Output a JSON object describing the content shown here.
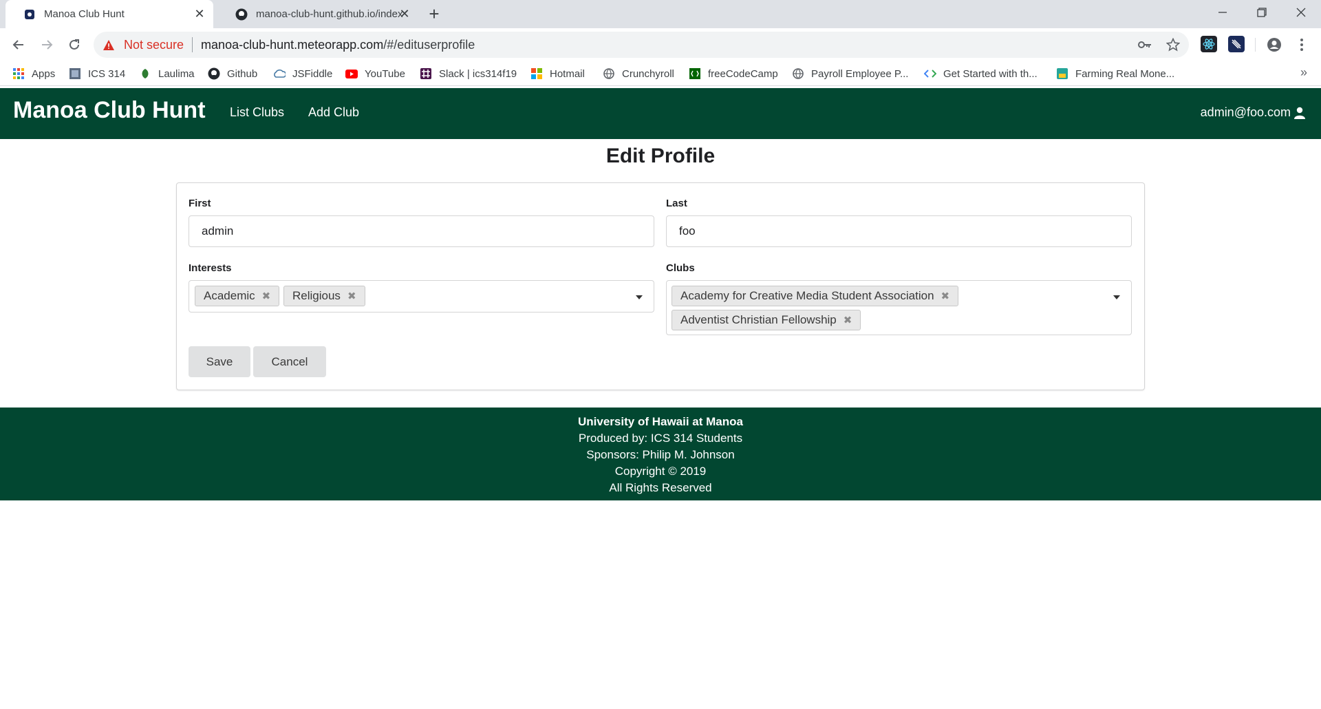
{
  "browser": {
    "tabs": [
      {
        "title": "Manoa Club Hunt",
        "active": true
      },
      {
        "title": "manoa-club-hunt.github.io/index",
        "active": false
      }
    ],
    "security_label": "Not secure",
    "url_host": "manoa-club-hunt.meteorapp.com",
    "url_path": "/#/edituserprofile",
    "bookmarks": [
      {
        "label": "Apps",
        "icon": "apps-grid-icon"
      },
      {
        "label": "ICS 314",
        "icon": "ics-icon"
      },
      {
        "label": "Laulima",
        "icon": "laulima-icon"
      },
      {
        "label": "Github",
        "icon": "github-icon"
      },
      {
        "label": "JSFiddle",
        "icon": "jsfiddle-icon"
      },
      {
        "label": "YouTube",
        "icon": "youtube-icon"
      },
      {
        "label": "Slack | ics314f19",
        "icon": "slack-icon"
      },
      {
        "label": "Hotmail",
        "icon": "microsoft-icon"
      },
      {
        "label": "Crunchyroll",
        "icon": "globe-icon"
      },
      {
        "label": "freeCodeCamp",
        "icon": "freecodecamp-icon"
      },
      {
        "label": "Payroll Employee P...",
        "icon": "globe-icon"
      },
      {
        "label": "Get Started with th...",
        "icon": "code-icon"
      },
      {
        "label": "Farming Real Mone...",
        "icon": "farm-icon"
      }
    ],
    "overflow_label": "»"
  },
  "nav": {
    "brand": "Manoa Club Hunt",
    "links": [
      "List Clubs",
      "Add Club"
    ],
    "user": "admin@foo.com"
  },
  "page": {
    "title": "Edit Profile",
    "form": {
      "first_label": "First",
      "first_value": "admin",
      "last_label": "Last",
      "last_value": "foo",
      "interests_label": "Interests",
      "interests": [
        "Academic",
        "Religious"
      ],
      "clubs_label": "Clubs",
      "clubs": [
        "Academy for Creative Media Student Association",
        "Adventist Christian Fellowship"
      ],
      "save_label": "Save",
      "cancel_label": "Cancel"
    }
  },
  "footer": {
    "org": "University of Hawaii at Manoa",
    "produced": "Produced by: ICS 314 Students",
    "sponsors": "Sponsors: Philip M. Johnson",
    "copyright": "Copyright © 2019",
    "rights": "All Rights Reserved"
  },
  "colors": {
    "brand_green": "#024731",
    "warning_red": "#d93025"
  }
}
